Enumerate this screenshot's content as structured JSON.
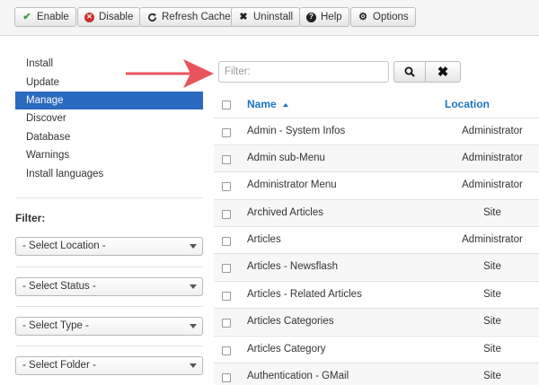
{
  "toolbar": {
    "buttons": [
      {
        "label": "Enable",
        "icon": "check-icon"
      },
      {
        "label": "Disable",
        "icon": "disable-icon"
      },
      {
        "label": "Refresh Cache",
        "icon": "refresh-icon"
      },
      {
        "label": "Uninstall",
        "icon": "x-icon"
      },
      {
        "label": "Help",
        "icon": "question-icon"
      },
      {
        "label": "Options",
        "icon": "gear-icon"
      }
    ]
  },
  "sidebar": {
    "items": [
      {
        "label": "Install"
      },
      {
        "label": "Update"
      },
      {
        "label": "Manage",
        "active": true
      },
      {
        "label": "Discover"
      },
      {
        "label": "Database"
      },
      {
        "label": "Warnings"
      },
      {
        "label": "Install languages"
      }
    ],
    "filter_title": "Filter:",
    "selects": [
      "- Select Location -",
      "- Select Status -",
      "- Select Type -",
      "- Select Folder -"
    ]
  },
  "search": {
    "placeholder": "Filter:",
    "value": ""
  },
  "annotation": {
    "color": "#e8545c"
  },
  "table": {
    "columns": {
      "name": "Name",
      "location": "Location"
    },
    "sort": "ascending",
    "rows": [
      {
        "name": "Admin - System Infos",
        "location": "Administrator"
      },
      {
        "name": "Admin sub-Menu",
        "location": "Administrator"
      },
      {
        "name": "Administrator Menu",
        "location": "Administrator"
      },
      {
        "name": "Archived Articles",
        "location": "Site"
      },
      {
        "name": "Articles",
        "location": "Administrator"
      },
      {
        "name": "Articles - Newsflash",
        "location": "Site"
      },
      {
        "name": "Articles - Related Articles",
        "location": "Site"
      },
      {
        "name": "Articles Categories",
        "location": "Site"
      },
      {
        "name": "Articles Category",
        "location": "Site"
      },
      {
        "name": "Authentication - GMail",
        "location": "Site"
      }
    ]
  },
  "colors": {
    "accent": "#2a6ac0",
    "link": "#1a75c0",
    "disable_icon": "#c9302c",
    "enable_icon": "#3c9a3c"
  }
}
